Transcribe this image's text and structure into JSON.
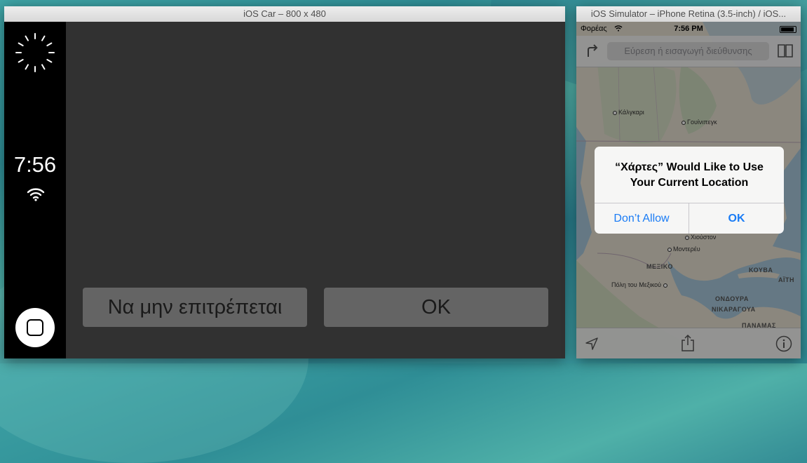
{
  "car_window": {
    "title": "iOS Car – 800 x 480",
    "time": "7:56",
    "deny_button": "Να μην επιτρέπεται",
    "ok_button": "OK"
  },
  "sim_window": {
    "title": "iOS Simulator – iPhone Retina (3.5-inch) / iOS...",
    "status": {
      "carrier": "Φορέας",
      "time": "7:56 PM"
    },
    "search": {
      "placeholder": "Εύρεση ή εισαγωγή διεύθυνσης"
    },
    "map_labels": {
      "calgary": "Κάλγκαρι",
      "winnipeg": "Γουίνιπεγκ",
      "houston": "Χιούστον",
      "monterrey": "Μοντερέυ",
      "mexico": "ΜΕΞΙΚΟ",
      "cuba": "ΚΟΥΒΑ",
      "haiti": "ΑΪΤΗ",
      "mexico_city": "Πόλη του Μεξικού",
      "honduras": "ΟΝΔΟΥΡΑ",
      "nicaragua": "ΝΙΚΑΡΑΓΟΥΑ",
      "panama": "ΠΑΝΑΜΑΣ"
    },
    "alert": {
      "title_line1": "“Χάρτες” Would Like to Use",
      "title_line2": "Your Current Location",
      "deny": "Don’t Allow",
      "ok": "OK"
    }
  },
  "icons": [
    "spinner-icon",
    "wifi-icon",
    "home-icon",
    "directions-icon",
    "bookmarks-icon",
    "location-arrow-icon",
    "share-icon",
    "info-icon",
    "battery-icon"
  ],
  "colors": {
    "ios_blue": "#1a7cf5",
    "car_bg": "#313131",
    "car_button": "#646464"
  }
}
